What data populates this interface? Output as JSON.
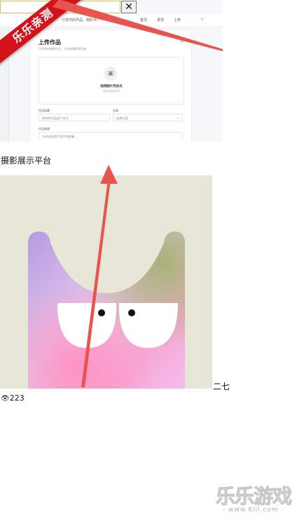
{
  "ribbon": {
    "label": "乐乐亲测"
  },
  "screenshot": {
    "close_label": "✕",
    "nav": {
      "brand": "分享你的作品，摄影师…",
      "links": [
        "首页",
        "发现",
        "上传"
      ]
    },
    "card": {
      "title": "上传作品",
      "subtitle": "分享你的摄影作品，与全球摄影爱好者",
      "dropzone_text": "拖拽图片到此处",
      "dropzone_hint": "或点击选择文件",
      "field_title_label": "作品标题",
      "field_title_placeholder": "给你的作品起个名字",
      "field_category_label": "分类",
      "field_category_value": "选择分类",
      "field_desc_label": "作品描述",
      "field_desc_placeholder": "分享这张照片背后的故事..."
    }
  },
  "page": {
    "title": "摄影展示平台",
    "author": "二七",
    "views_icon": "eye-icon",
    "views": "223"
  },
  "watermark": {
    "logo": "乐乐游戏",
    "url": "- www.6lll.com -"
  },
  "colors": {
    "arrow": "#e85450",
    "ribbon": "#d4121a",
    "art_bg": "#e6e7d7"
  }
}
